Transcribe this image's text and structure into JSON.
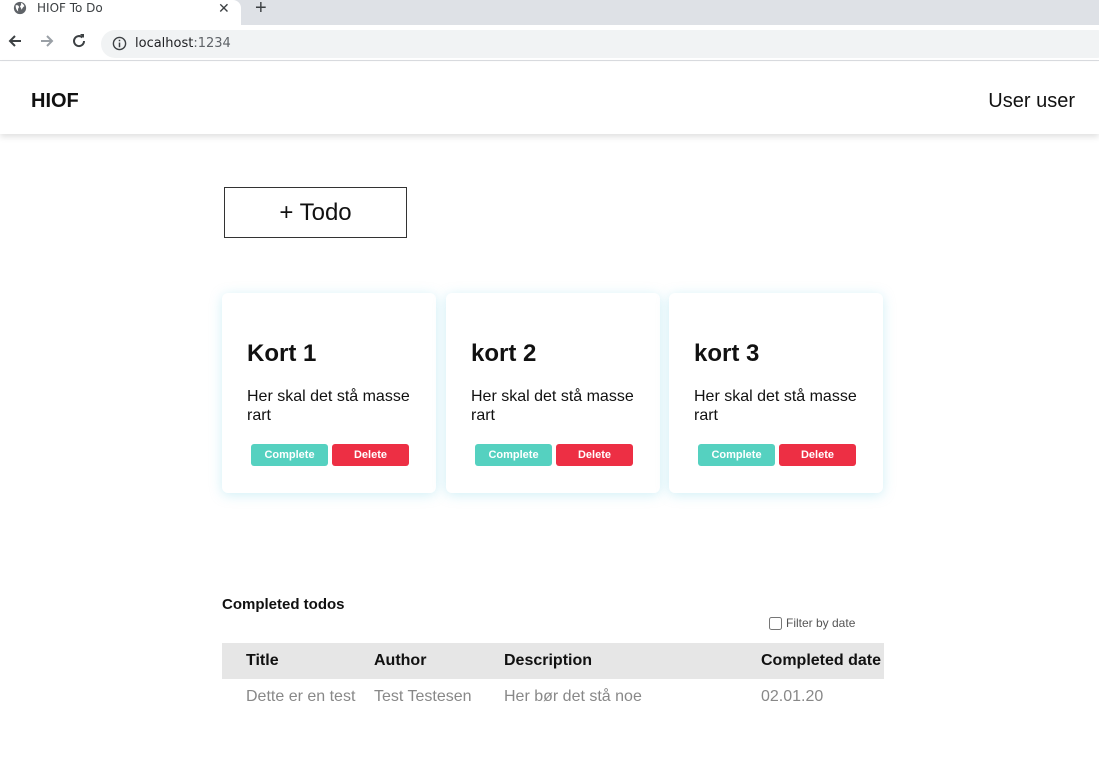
{
  "browser": {
    "tab_title": "HIOF To Do",
    "url_host": "localhost",
    "url_port": ":1234"
  },
  "navbar": {
    "brand": "HIOF",
    "user": "User user"
  },
  "add_button_label": "+ Todo",
  "cards": [
    {
      "title": "Kort 1",
      "description": "Her skal det stå masse rart",
      "complete_label": "Complete",
      "delete_label": "Delete"
    },
    {
      "title": "kort 2",
      "description": "Her skal det stå masse rart",
      "complete_label": "Complete",
      "delete_label": "Delete"
    },
    {
      "title": "kort 3",
      "description": "Her skal det stå masse rart",
      "complete_label": "Complete",
      "delete_label": "Delete"
    }
  ],
  "completed": {
    "title": "Completed todos",
    "filter_label": "Filter by date",
    "columns": [
      "Title",
      "Author",
      "Description",
      "Completed date"
    ],
    "rows": [
      [
        "Dette er en test",
        "Test Testesen",
        "Her bør det stå noe",
        "02.01.20"
      ]
    ]
  },
  "colors": {
    "complete": "#55d1c0",
    "delete": "#ed2f44",
    "table_header": "#e6e6e6"
  }
}
